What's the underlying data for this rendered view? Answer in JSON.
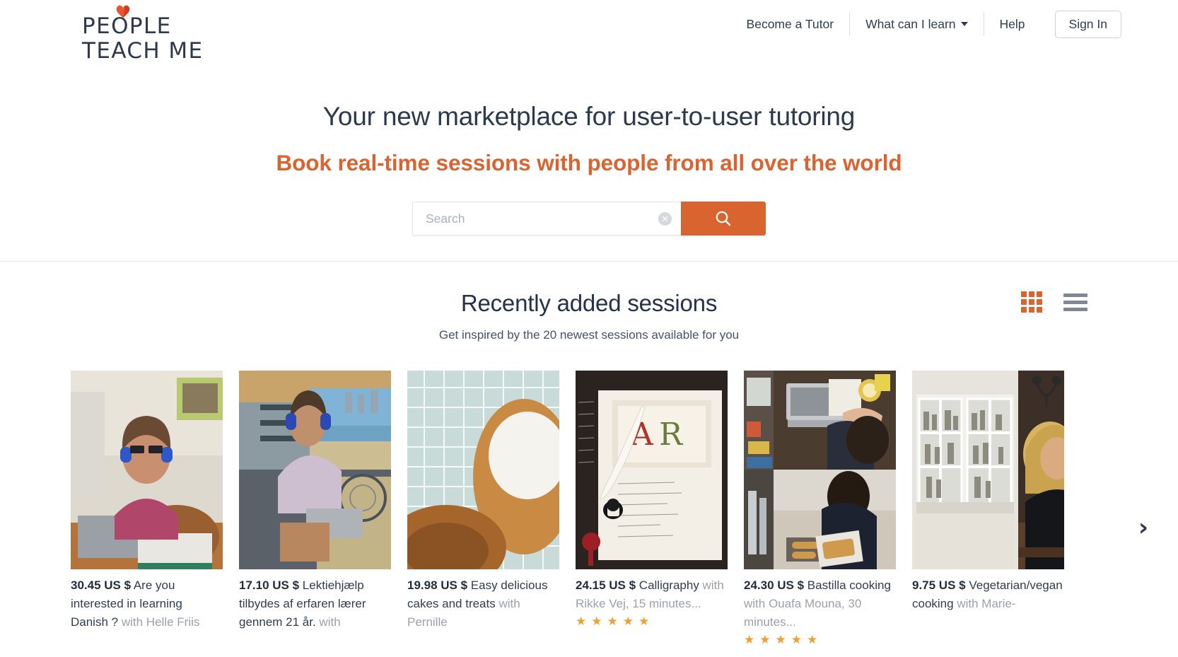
{
  "brand": {
    "logo_line1": "PEOPLE",
    "logo_line2": "TEACH ME",
    "accent_color": "#d9642f",
    "dark_color": "#2e3a4c"
  },
  "nav": {
    "items": [
      {
        "label": "Become a Tutor",
        "has_caret": false
      },
      {
        "label": "What can I learn",
        "has_caret": true
      },
      {
        "label": "Help",
        "has_caret": false
      }
    ],
    "sign_in_label": "Sign In"
  },
  "hero": {
    "title": "Your new marketplace for user-to-user tutoring",
    "subtitle": "Book real-time sessions with people from all over the world"
  },
  "search": {
    "placeholder": "Search",
    "value": "",
    "clear_icon": "close-icon",
    "button_icon": "search-icon"
  },
  "section": {
    "title": "Recently added sessions",
    "subtitle": "Get inspired by the 20 newest sessions available for you",
    "view_grid_icon": "grid-view-icon",
    "view_list_icon": "list-view-icon",
    "next_arrow": "›"
  },
  "cards": [
    {
      "price": "30.45 US $",
      "title": " Are you interested in learning Danish ?",
      "meta": " with Helle Friis",
      "stars": ""
    },
    {
      "price": "17.10 US $",
      "title": " Lektiehjælp tilbydes af erfaren lærer gennem 21 år.",
      "meta": " with",
      "stars": ""
    },
    {
      "price": "19.98 US $",
      "title": " Easy delicious cakes and treats",
      "meta": " with Pernille",
      "stars": ""
    },
    {
      "price": "24.15 US $",
      "title": " Calligraphy",
      "meta": " with Rikke Vej, 15 minutes...",
      "stars": "★★★★★"
    },
    {
      "price": "24.30 US $",
      "title": " Bastilla cooking",
      "meta": " with Ouafa Mouna, 30 minutes...",
      "stars": "★★★★★"
    },
    {
      "price": "9.75 US $",
      "title": " Vegetarian/vegan cooking",
      "meta": " with Marie-",
      "stars": ""
    }
  ]
}
